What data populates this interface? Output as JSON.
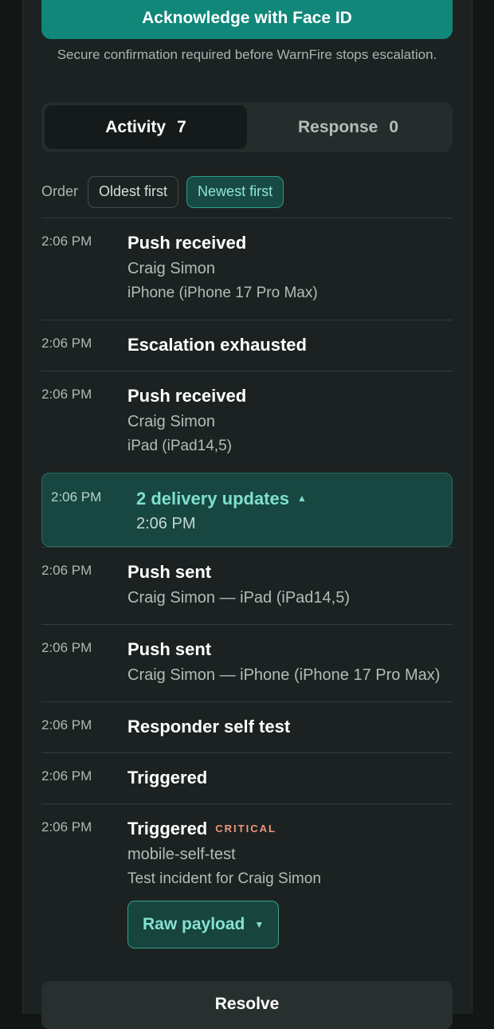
{
  "acknowledge": {
    "button_label": "Acknowledge with Face ID",
    "note": "Secure confirmation required before WarnFire stops escalation."
  },
  "tabs": [
    {
      "label": "Activity",
      "count": "7",
      "active": true
    },
    {
      "label": "Response",
      "count": "0",
      "active": false
    }
  ],
  "order": {
    "label": "Order",
    "options": [
      "Oldest first",
      "Newest first"
    ],
    "selected": "Newest first"
  },
  "entries": [
    {
      "time": "2:06 PM",
      "title": "Push received",
      "lines": [
        "Craig Simon",
        "iPhone (iPhone 17 Pro Max)"
      ]
    },
    {
      "time": "2:06 PM",
      "title": "Escalation exhausted",
      "lines": []
    },
    {
      "time": "2:06 PM",
      "title": "Push received",
      "lines": [
        "Craig Simon",
        "iPad (iPad14,5)"
      ]
    },
    {
      "time": "2:06 PM",
      "title": "2 delivery updates",
      "sub": "2:06 PM",
      "group": true,
      "expanded": true
    },
    {
      "time": "2:06 PM",
      "title": "Push sent",
      "lines": [
        "Craig Simon — iPad (iPad14,5)"
      ]
    },
    {
      "time": "2:06 PM",
      "title": "Push sent",
      "lines": [
        "Craig Simon — iPhone (iPhone 17 Pro Max)"
      ]
    },
    {
      "time": "2:06 PM",
      "title": "Responder self test",
      "lines": []
    },
    {
      "time": "2:06 PM",
      "title": "Triggered",
      "lines": []
    },
    {
      "time": "2:06 PM",
      "title": "Triggered",
      "badge": "CRITICAL",
      "lines": [
        "mobile-self-test",
        "Test incident for Craig Simon"
      ],
      "button": "Raw payload"
    }
  ],
  "resolve": {
    "label": "Resolve"
  },
  "colors": {
    "accent": "#11877a",
    "selected_chip": "#174a42",
    "critical": "#f0957c"
  }
}
